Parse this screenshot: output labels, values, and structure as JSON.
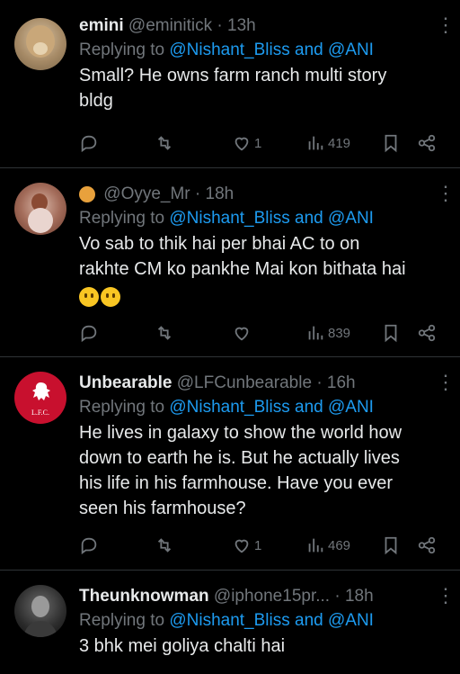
{
  "tweets": [
    {
      "name": "emini",
      "handle": "@eminitick",
      "time": "· 13h",
      "replying_prefix": "Replying to",
      "replying_to": "@Nishant_Bliss and @ANI",
      "text_lines": [
        "Small? He owns farm ranch multi story",
        "bldg"
      ],
      "likes": "1",
      "views": "419"
    },
    {
      "name": "",
      "handle": "@Oyye_Mr",
      "time": "· 18h",
      "replying_prefix": "Replying to",
      "replying_to": "@Nishant_Bliss and @ANI",
      "text_lines": [
        "Vo sab to thik hai per bhai AC to on",
        "rakhte CM ko pankhe Mai kon bithata hai"
      ],
      "likes": "",
      "views": "839"
    },
    {
      "name": "Unbearable",
      "handle": "@LFCunbearable",
      "time": "· 16h",
      "replying_prefix": "Replying to",
      "replying_to": "@Nishant_Bliss and @ANI",
      "text_lines": [
        "He lives in galaxy to show the world how",
        "down to earth he is. But he actually lives",
        "his life in his farmhouse. Have you ever",
        "seen his farmhouse?"
      ],
      "likes": "1",
      "views": "469",
      "avatar_text": "L.F.C."
    },
    {
      "name": "Theunknowman",
      "handle": "@iphone15pr...",
      "time": "· 18h",
      "replying_prefix": "Replying to",
      "replying_to": "@Nishant_Bliss and @ANI",
      "text_lines": [
        "3 bhk mei goliya chalti hai"
      ],
      "likes": "",
      "views": ""
    }
  ],
  "more_icon": "⋮",
  "colors": {
    "background": "#000000",
    "text": "#e7e9ea",
    "muted": "#71767b",
    "link": "#1d9bf0",
    "divider": "#2f3336"
  }
}
